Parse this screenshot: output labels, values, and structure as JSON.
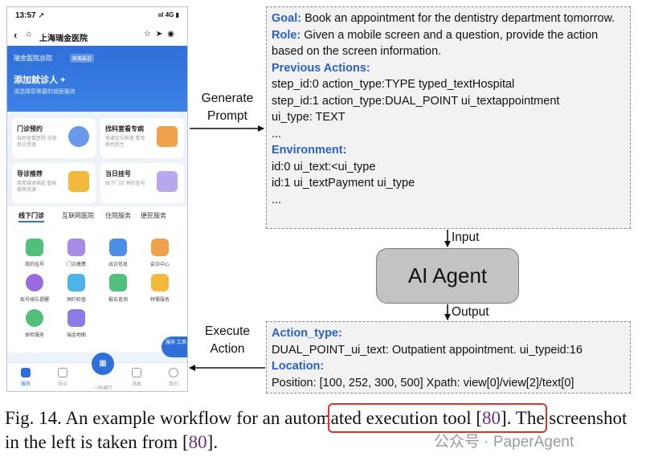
{
  "phone": {
    "status_time": "13:57 ➚",
    "status_net": "ııl 4G ▮",
    "nav_title": "上海瑞金医院",
    "hero_location": "瑞金医院总院",
    "hero_badge": "距离最近",
    "hero_add": "添加就诊人 +",
    "hero_sub": "请选择您需要的就医服务",
    "cards": [
      {
        "title": "门诊预约",
        "desc": "自助查看医院 全部就诊资源"
      },
      {
        "title": "找科室看专病",
        "desc": "快速定位科室 看专病找医生"
      },
      {
        "title": "导诊推荐",
        "desc": "简单描述病症 智能推荐资源"
      },
      {
        "title": "当日挂号",
        "desc": "线下门诊 预约挂号"
      }
    ],
    "tabs": [
      "线下门诊",
      "互联网医院",
      "住院服务",
      "便民服务"
    ],
    "grid_items": [
      "我的挂号",
      "门诊缴费",
      "出诊信息",
      "会诊中心",
      "取号排队提醒",
      "预约检查",
      "报告查询",
      "特需服务",
      "体检服务",
      "瑞金地图"
    ],
    "float_label": "服务 工具",
    "bottom_nav": [
      "服务",
      "导诊",
      "一码通行",
      "消息",
      "我的"
    ],
    "qr_glyph": "▦"
  },
  "prompt_box": {
    "goal_key": "Goal:",
    "goal_text": "Book an appointment for the dentistry department tomorrow.",
    "role_key": "Role:",
    "role_text": "Given a mobile screen and a question, provide the action based on the screen information.",
    "prev_key": "Previous Actions:",
    "prev_lines": [
      "step_id:0 action_type:TYPE typed_textHospital",
      "step_id:1 action_type:DUAL_POINT ui_textappointment",
      "ui_type: TEXT",
      "..."
    ],
    "env_key": "Environment:",
    "env_lines": [
      "id:0 ui_text:<ui_type",
      "id:1 ui_textPayment ui_type",
      "..."
    ]
  },
  "output_box": {
    "action_key": "Action_type:",
    "action_text": "DUAL_POINT_ui_text: Outpatient appointment. ui_typeid:16",
    "location_key": "Location:",
    "location_text": "Position: [100, 252, 300, 500] Xpath: view[0]/view[2]/text[0]"
  },
  "labels": {
    "generate_1": "Generate",
    "generate_2": "Prompt",
    "execute_1": "Execute",
    "execute_2": "Action",
    "input": "Input",
    "output": "Output",
    "agent": "AI Agent"
  },
  "caption": {
    "part1": "Fig. 14.  An example workflow for an automated execution tool [",
    "ref1": "80",
    "part2": "]. The screenshot in the left is taken from [",
    "ref2": "80",
    "part3": "]."
  },
  "watermark": "公众号 · PaperAgent",
  "colors": {
    "key_blue": "#2a61c9",
    "highlight_red": "#e0322c",
    "ref_purple": "#6b2f86",
    "agent_fill": "#c3c3c3"
  }
}
